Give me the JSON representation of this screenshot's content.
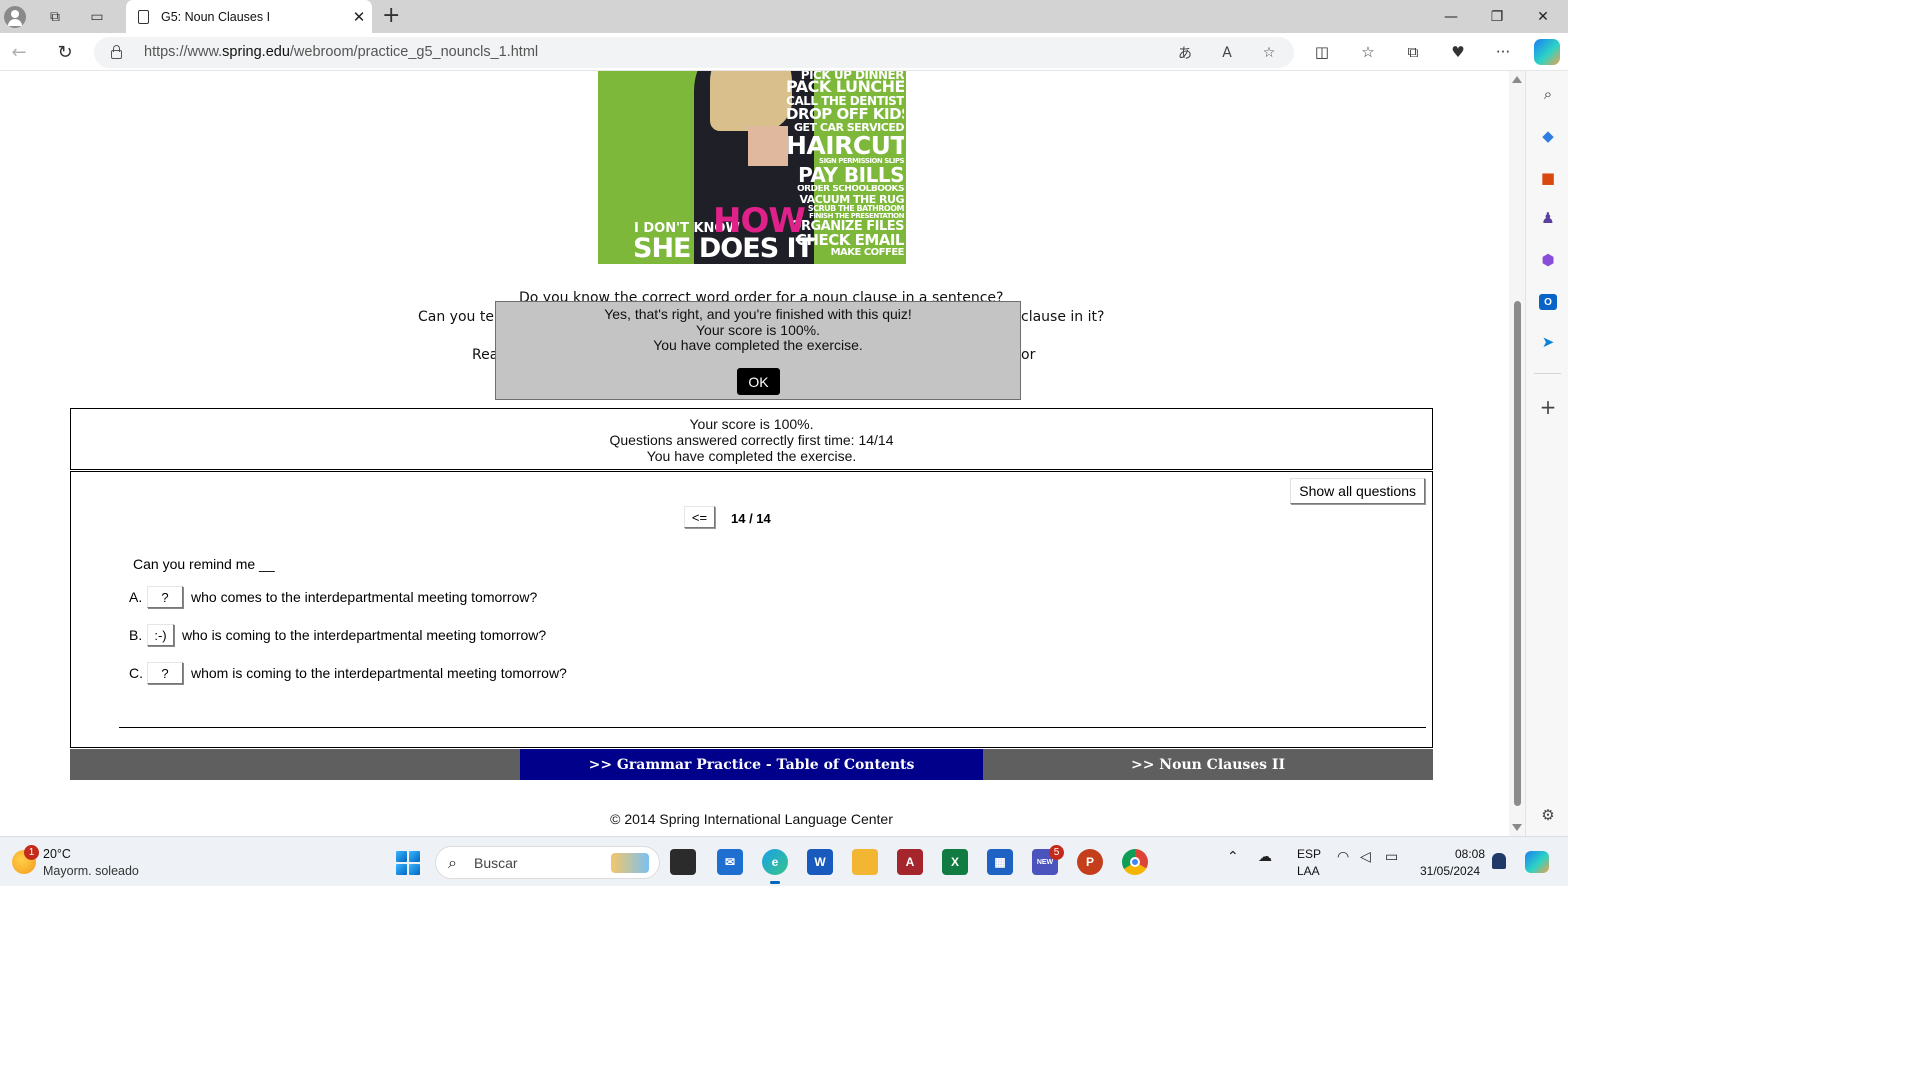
{
  "browser": {
    "tab_title": "G5: Noun Clauses I",
    "url_prefix": "https://www.",
    "url_domain": "spring.edu",
    "url_path": "/webroom/practice_g5_nouncls_1.html"
  },
  "poster": {
    "chores": [
      "PICK UP DINNER",
      "PACK LUNCHES",
      "CALL THE DENTIST",
      "DROP OFF KIDS",
      "GET CAR SERVICED",
      "HAIRCUT",
      "SIGN PERMISSION SLIPS",
      "PAY BILLS",
      "ORDER SCHOOLBOOKS",
      "VACUUM THE RUG",
      "SCRUB THE BATHROOM",
      "FINISH THE PRESENTATION",
      "ORGANIZE FILES",
      "CHECK EMAIL",
      "MAKE COFFEE"
    ],
    "tagline_small": "I DON'T KNOW",
    "tagline_how": "HOW",
    "tagline_main": "SHE DOES IT",
    "colors": {
      "background": "#7db83a",
      "accent": "#e0218a"
    }
  },
  "intro": {
    "line1": "Do you know the correct word order for a noun clause in a sentence?",
    "line2_left": "Can you tel",
    "line2_right": "clause in it?",
    "line3_left": "Rea",
    "line3_right": "or"
  },
  "dialog": {
    "line1": "Yes, that's right, and you're finished with this quiz!",
    "line2": "Your score is 100%.",
    "line3": "You have completed the exercise.",
    "ok_label": "OK"
  },
  "score": {
    "line1": "Your score is 100%.",
    "line2": "Questions answered correctly first time: 14/14",
    "line3": "You have completed the exercise."
  },
  "quiz": {
    "show_all_label": "Show all questions",
    "prev_label": "<=",
    "counter": "14 / 14",
    "question": "Can you remind me __",
    "options": [
      {
        "letter": "A.",
        "button": "?",
        "text": "who comes to the interdepartmental meeting tomorrow?"
      },
      {
        "letter": "B.",
        "button": ":-)",
        "text": "who is coming to the interdepartmental meeting tomorrow?"
      },
      {
        "letter": "C.",
        "button": "?",
        "text": "whom is coming to the interdepartmental meeting tomorrow?"
      }
    ]
  },
  "footer_nav": {
    "toc_label": ">>  Grammar Practice - Table of Contents",
    "next_label": ">>  Noun Clauses II",
    "colors": {
      "toc_bg": "#00008b",
      "bar_bg": "#5f5f5f"
    }
  },
  "copyright": "© 2014 Spring International Language Center",
  "taskbar": {
    "weather_temp": "20°C",
    "weather_desc": "Mayorm. soleado",
    "weather_badge": "1",
    "search_placeholder": "Buscar",
    "teams_badge": "5",
    "teams_label": "NEW",
    "lang1": "ESP",
    "lang2": "LAA",
    "time": "08:08",
    "date": "31/05/2024"
  }
}
